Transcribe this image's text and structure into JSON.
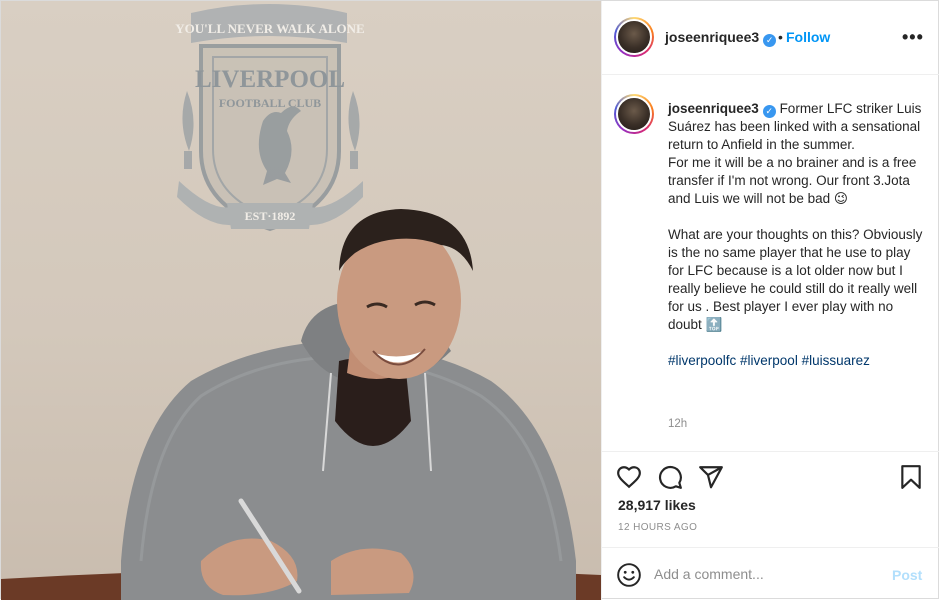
{
  "photo": {
    "crest_motto": "YOU'LL NEVER WALK ALONE",
    "crest_name": "LIVERPOOL",
    "crest_sub": "FOOTBALL CLUB",
    "crest_est": "EST·1892"
  },
  "header": {
    "username": "joseenriquee3",
    "verified_mark": "✓",
    "dot": "•",
    "follow_label": "Follow",
    "more_label": "•••"
  },
  "caption": {
    "username": "joseenriquee3",
    "p1": "Former LFC striker Luis Suárez has been linked with a sensational return to Anfield in the summer.",
    "p2": "For me it will be a no brainer and is a free transfer if I'm not wrong. Our front 3.Jota and Luis we will not be bad 😉",
    "p3": "What are your thoughts on this? Obviously is the no same player that he use to play for LFC because is a lot older now but I really believe he could still do it really well for us . Best player I ever play with no doubt 🔝",
    "hashtags": "#liverpoolfc #liverpool #luissuarez",
    "time": "12h"
  },
  "actions": {
    "icons": [
      "heart-icon",
      "comment-icon",
      "share-icon",
      "bookmark-icon"
    ]
  },
  "likes": "28,917 likes",
  "ago": "12 HOURS AGO",
  "add_comment": {
    "placeholder": "Add a comment...",
    "post_label": "Post"
  },
  "colors": {
    "follow": "#0095f6",
    "hashtag": "#00376b",
    "post_disabled": "#b2dffc",
    "verified": "#3897f0"
  }
}
